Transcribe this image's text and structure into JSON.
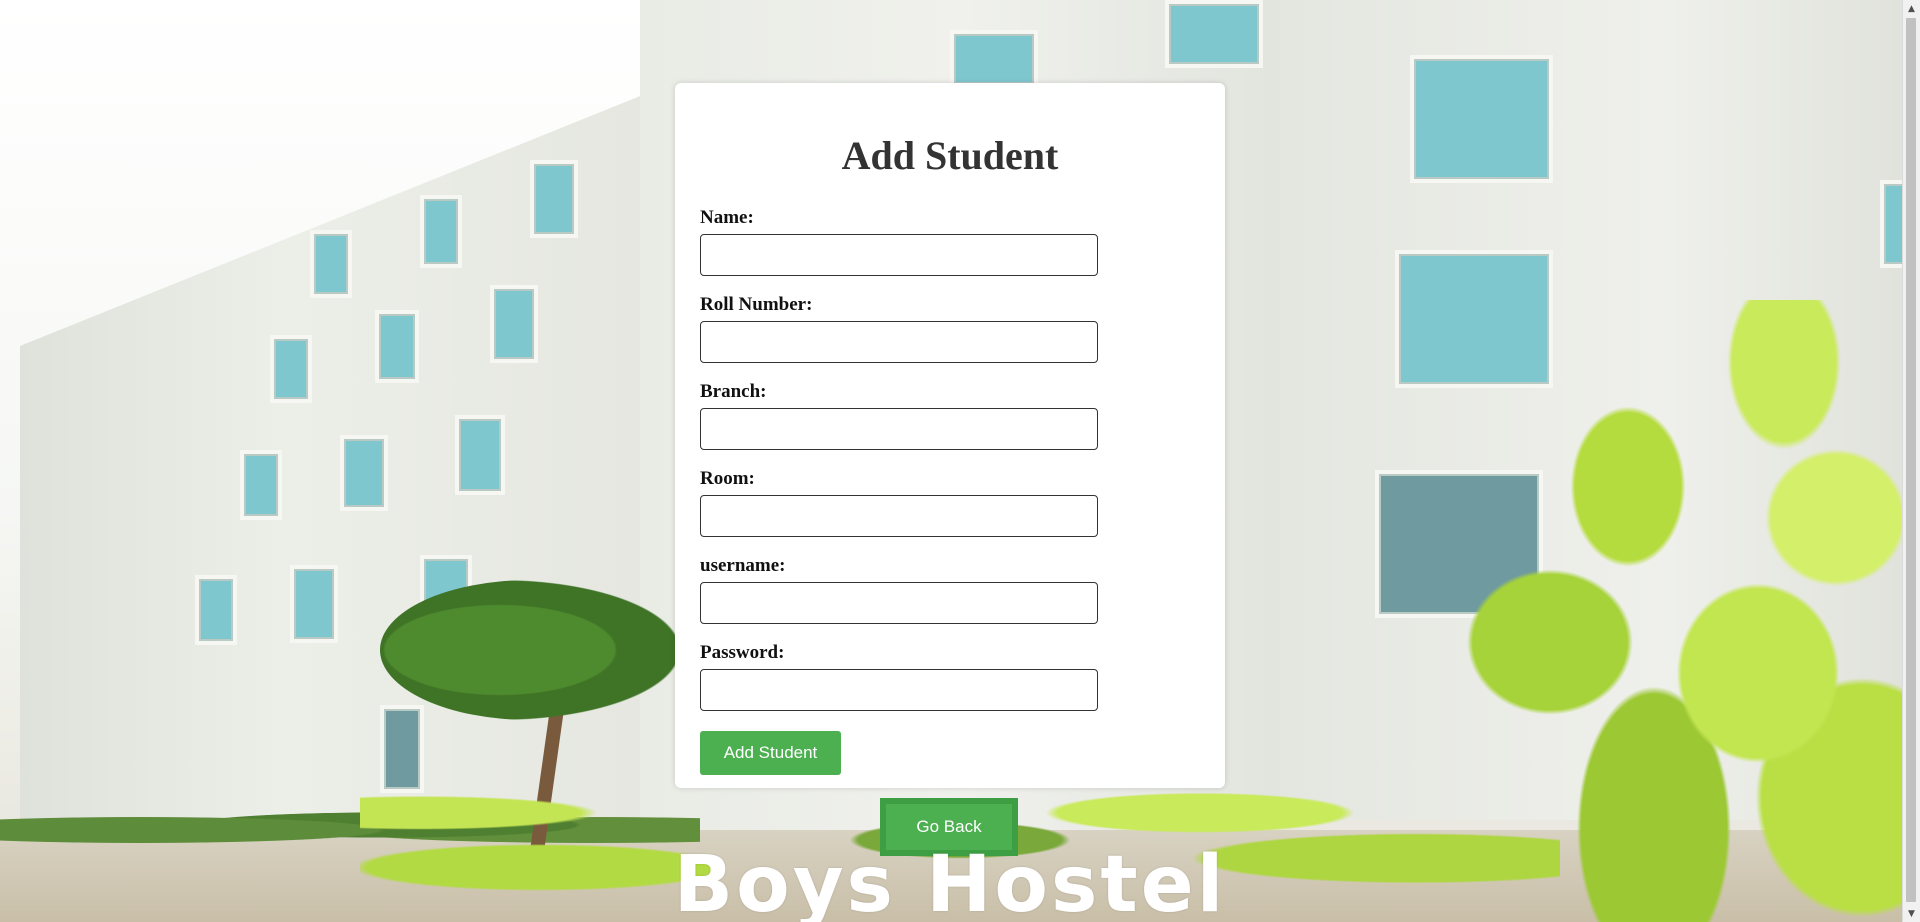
{
  "form": {
    "title": "Add Student",
    "fields": [
      {
        "label": "Name:",
        "value": "",
        "placeholder": ""
      },
      {
        "label": "Roll Number:",
        "value": "",
        "placeholder": ""
      },
      {
        "label": "Branch:",
        "value": "",
        "placeholder": ""
      },
      {
        "label": "Room:",
        "value": "",
        "placeholder": ""
      },
      {
        "label": "username:",
        "value": "",
        "placeholder": ""
      },
      {
        "label": "Password:",
        "value": "",
        "placeholder": ""
      }
    ],
    "submit_label": "Add Student"
  },
  "navigation": {
    "back_label": "Go Back"
  },
  "banner": {
    "text": "Boys Hostel"
  },
  "colors": {
    "button_green": "#4caf50",
    "button_border_green": "#3e9e43",
    "card_background": "#ffffff",
    "title_text": "#333333"
  },
  "icons": {
    "scroll_up": "scroll-up-arrow-icon",
    "scroll_down": "scroll-down-arrow-icon"
  }
}
